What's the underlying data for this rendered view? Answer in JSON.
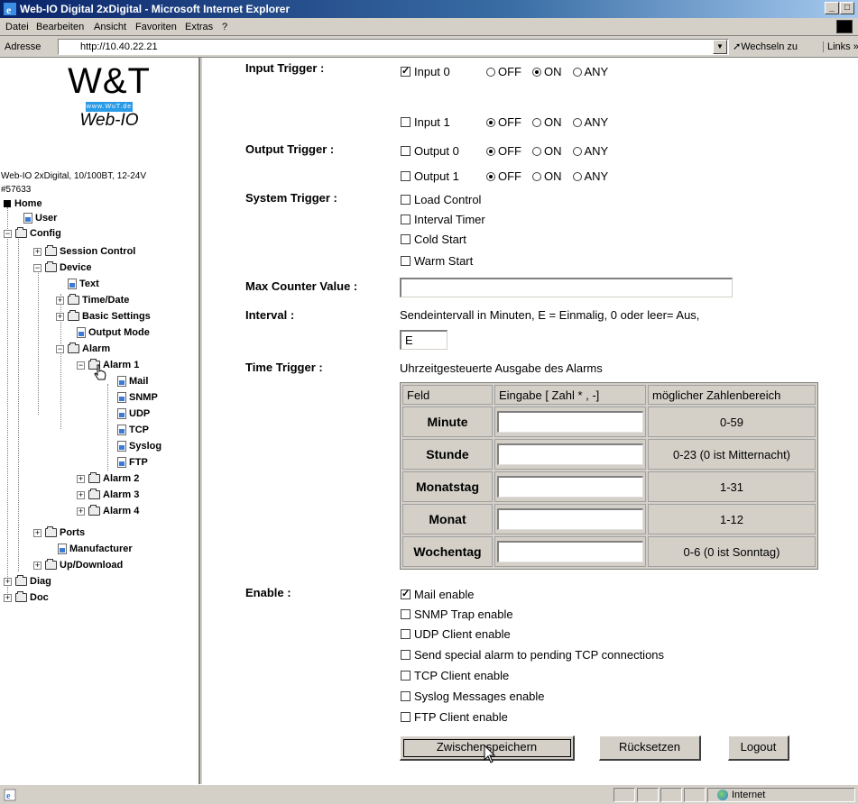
{
  "window": {
    "title": "Web-IO Digital 2xDigital - Microsoft Internet Explorer"
  },
  "menu": [
    "Datei",
    "Bearbeiten",
    "Ansicht",
    "Favoriten",
    "Extras",
    "?"
  ],
  "address": {
    "label": "Adresse",
    "url": "http://10.40.22.21",
    "go_label": "Wechseln zu",
    "links_label": "Links"
  },
  "logo": {
    "brand": "W&T",
    "url_text": "www.WuT.de",
    "product": "Web-IO"
  },
  "device_info": {
    "line1": "Web-IO 2xDigital, 10/100BT, 12-24V",
    "line2": "#57633"
  },
  "tree": {
    "home": "Home",
    "user": "User",
    "config": "Config",
    "session_control": "Session Control",
    "device": "Device",
    "text": "Text",
    "time_date": "Time/Date",
    "basic_settings": "Basic Settings",
    "output_mode": "Output Mode",
    "alarm": "Alarm",
    "alarm1": "Alarm 1",
    "mail": "Mail",
    "snmp": "SNMP",
    "udp": "UDP",
    "tcp": "TCP",
    "syslog": "Syslog",
    "ftp": "FTP",
    "alarm2": "Alarm 2",
    "alarm3": "Alarm 3",
    "alarm4": "Alarm 4",
    "ports": "Ports",
    "manufacturer": "Manufacturer",
    "updownload": "Up/Download",
    "diag": "Diag",
    "doc": "Doc"
  },
  "form": {
    "input_trigger_label": "Input Trigger :",
    "input0": {
      "label": "Input 0",
      "checked": true,
      "selected": "ON"
    },
    "input1": {
      "label": "Input 1",
      "checked": false,
      "selected": "OFF"
    },
    "opt_off": "OFF",
    "opt_on": "ON",
    "opt_any": "ANY",
    "output_trigger_label": "Output Trigger :",
    "output0": {
      "label": "Output 0",
      "checked": false,
      "selected": "OFF"
    },
    "output1": {
      "label": "Output 1",
      "checked": false,
      "selected": "OFF"
    },
    "system_trigger_label": "System Trigger :",
    "system": [
      "Load Control",
      "Interval Timer",
      "Cold Start",
      "Warm Start"
    ],
    "max_counter_label": "Max Counter Value :",
    "max_counter_value": "",
    "interval_label": "Interval :",
    "interval_note": "Sendeintervall in Minuten, E = Einmalig, 0 oder leer= Aus,",
    "interval_value": "E",
    "time_trigger_label": "Time Trigger :",
    "time_trigger_note": "Uhrzeitgesteuerte Ausgabe des Alarms",
    "table_headers": [
      "Feld",
      "Eingabe [ Zahl * , -]",
      "möglicher Zahlenbereich"
    ],
    "table_rows": [
      {
        "field": "Minute",
        "value": "",
        "range": "0-59"
      },
      {
        "field": "Stunde",
        "value": "",
        "range": "0-23 (0 ist Mitternacht)"
      },
      {
        "field": "Monatstag",
        "value": "",
        "range": "1-31"
      },
      {
        "field": "Monat",
        "value": "",
        "range": "1-12"
      },
      {
        "field": "Wochentag",
        "value": "",
        "range": "0-6 (0 ist Sonntag)"
      }
    ],
    "enable_label": "Enable :",
    "enable": [
      {
        "label": "Mail enable",
        "checked": true
      },
      {
        "label": "SNMP Trap enable",
        "checked": false
      },
      {
        "label": "UDP Client enable",
        "checked": false
      },
      {
        "label": "Send special alarm to pending TCP connections",
        "checked": false
      },
      {
        "label": "TCP Client enable",
        "checked": false
      },
      {
        "label": "Syslog Messages enable",
        "checked": false
      },
      {
        "label": "FTP Client enable",
        "checked": false
      }
    ],
    "buttons": {
      "save": "Zwischenspeichern",
      "reset": "Rücksetzen",
      "logout": "Logout"
    }
  },
  "status": {
    "zone": "Internet"
  }
}
